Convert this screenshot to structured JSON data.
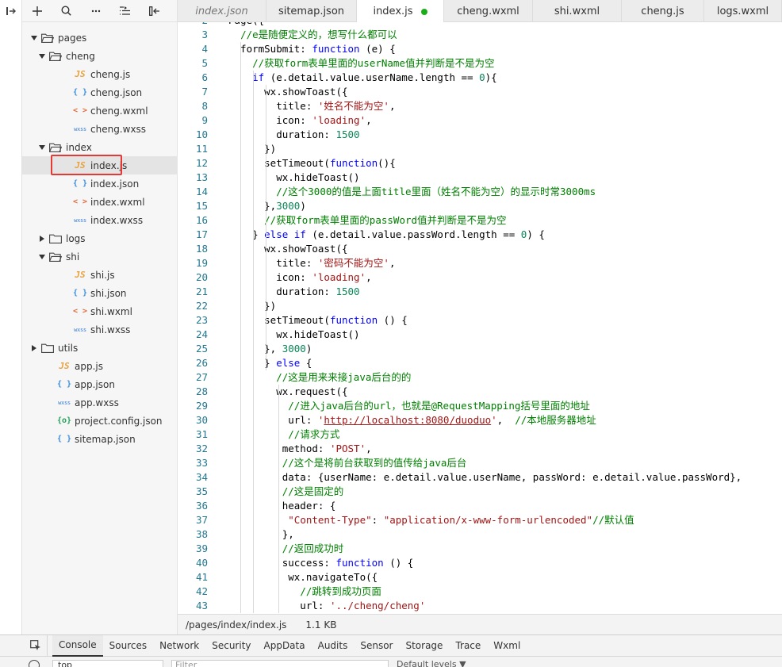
{
  "sidebar": {
    "toolbar_icons": [
      "add-icon",
      "search-icon",
      "more-icon",
      "outline-icon",
      "collapse-icon"
    ],
    "tree": [
      {
        "label": "pages",
        "kind": "folder",
        "expanded": true,
        "depth": 0
      },
      {
        "label": "cheng",
        "kind": "folder",
        "expanded": true,
        "depth": 1
      },
      {
        "label": "cheng.js",
        "kind": "js",
        "depth": 2
      },
      {
        "label": "cheng.json",
        "kind": "json",
        "depth": 2
      },
      {
        "label": "cheng.wxml",
        "kind": "wxml",
        "depth": 2
      },
      {
        "label": "cheng.wxss",
        "kind": "wxss",
        "depth": 2
      },
      {
        "label": "index",
        "kind": "folder",
        "expanded": true,
        "depth": 1
      },
      {
        "label": "index.js",
        "kind": "js",
        "depth": 2,
        "selected": true
      },
      {
        "label": "index.json",
        "kind": "json",
        "depth": 2
      },
      {
        "label": "index.wxml",
        "kind": "wxml",
        "depth": 2
      },
      {
        "label": "index.wxss",
        "kind": "wxss",
        "depth": 2
      },
      {
        "label": "logs",
        "kind": "folder",
        "expanded": false,
        "depth": 1
      },
      {
        "label": "shi",
        "kind": "folder",
        "expanded": true,
        "depth": 1
      },
      {
        "label": "shi.js",
        "kind": "js",
        "depth": 2
      },
      {
        "label": "shi.json",
        "kind": "json",
        "depth": 2
      },
      {
        "label": "shi.wxml",
        "kind": "wxml",
        "depth": 2
      },
      {
        "label": "shi.wxss",
        "kind": "wxss",
        "depth": 2
      },
      {
        "label": "utils",
        "kind": "folder",
        "expanded": false,
        "depth": 0
      },
      {
        "label": "app.js",
        "kind": "js",
        "depth": 1
      },
      {
        "label": "app.json",
        "kind": "json",
        "depth": 1
      },
      {
        "label": "app.wxss",
        "kind": "wxss",
        "depth": 1
      },
      {
        "label": "project.config.json",
        "kind": "cfg",
        "depth": 1
      },
      {
        "label": "sitemap.json",
        "kind": "json",
        "depth": 1
      }
    ],
    "file_icon_text": {
      "js": "JS",
      "json": "{ }",
      "wxml": "< >",
      "wxss": "wxss",
      "cfg": "{o}"
    }
  },
  "tabs": [
    {
      "label": "index.json",
      "preview": true
    },
    {
      "label": "sitemap.json"
    },
    {
      "label": "index.js",
      "active": true,
      "modified": true
    },
    {
      "label": "cheng.wxml"
    },
    {
      "label": "shi.wxml"
    },
    {
      "label": "cheng.js"
    },
    {
      "label": "logs.wxml"
    }
  ],
  "editor": {
    "first_line": 2,
    "lines": [
      [
        {
          "t": "Page({",
          "c": ""
        }
      ],
      [
        {
          "t": "  ",
          "c": ""
        },
        {
          "t": "//e是随便定义的，想写什么都可以",
          "c": "c"
        }
      ],
      [
        {
          "t": "  formSubmit: ",
          "c": ""
        },
        {
          "t": "function",
          "c": "k"
        },
        {
          "t": " (e) {",
          "c": ""
        }
      ],
      [
        {
          "t": "    ",
          "c": ""
        },
        {
          "t": "//获取form表单里面的userName值并判断是不是为空",
          "c": "c"
        }
      ],
      [
        {
          "t": "    ",
          "c": ""
        },
        {
          "t": "if",
          "c": "k"
        },
        {
          "t": " (e.detail.value.userName.length == ",
          "c": ""
        },
        {
          "t": "0",
          "c": "n"
        },
        {
          "t": "){",
          "c": ""
        }
      ],
      [
        {
          "t": "      wx.showToast({",
          "c": ""
        }
      ],
      [
        {
          "t": "        title: ",
          "c": ""
        },
        {
          "t": "'姓名不能为空'",
          "c": "s"
        },
        {
          "t": ",",
          "c": ""
        }
      ],
      [
        {
          "t": "        icon: ",
          "c": ""
        },
        {
          "t": "'loading'",
          "c": "s"
        },
        {
          "t": ",",
          "c": ""
        }
      ],
      [
        {
          "t": "        duration: ",
          "c": ""
        },
        {
          "t": "1500",
          "c": "n"
        }
      ],
      [
        {
          "t": "      })",
          "c": ""
        }
      ],
      [
        {
          "t": "      setTimeout(",
          "c": ""
        },
        {
          "t": "function",
          "c": "k"
        },
        {
          "t": "(){",
          "c": ""
        }
      ],
      [
        {
          "t": "        wx.hideToast()",
          "c": ""
        }
      ],
      [
        {
          "t": "        ",
          "c": ""
        },
        {
          "t": "//这个3000的值是上面title里面（姓名不能为空）的显示时常3000ms",
          "c": "c"
        }
      ],
      [
        {
          "t": "      },",
          "c": ""
        },
        {
          "t": "3000",
          "c": "n"
        },
        {
          "t": ")",
          "c": ""
        }
      ],
      [
        {
          "t": "      ",
          "c": ""
        },
        {
          "t": "//获取form表单里面的passWord值并判断是不是为空",
          "c": "c"
        }
      ],
      [
        {
          "t": "    } ",
          "c": ""
        },
        {
          "t": "else if",
          "c": "k"
        },
        {
          "t": " (e.detail.value.passWord.length == ",
          "c": ""
        },
        {
          "t": "0",
          "c": "n"
        },
        {
          "t": ") {",
          "c": ""
        }
      ],
      [
        {
          "t": "      wx.showToast({",
          "c": ""
        }
      ],
      [
        {
          "t": "        title: ",
          "c": ""
        },
        {
          "t": "'密码不能为空'",
          "c": "s"
        },
        {
          "t": ",",
          "c": ""
        }
      ],
      [
        {
          "t": "        icon: ",
          "c": ""
        },
        {
          "t": "'loading'",
          "c": "s"
        },
        {
          "t": ",",
          "c": ""
        }
      ],
      [
        {
          "t": "        duration: ",
          "c": ""
        },
        {
          "t": "1500",
          "c": "n"
        }
      ],
      [
        {
          "t": "      })",
          "c": ""
        }
      ],
      [
        {
          "t": "      setTimeout(",
          "c": ""
        },
        {
          "t": "function",
          "c": "k"
        },
        {
          "t": " () {",
          "c": ""
        }
      ],
      [
        {
          "t": "        wx.hideToast()",
          "c": ""
        }
      ],
      [
        {
          "t": "      }, ",
          "c": ""
        },
        {
          "t": "3000",
          "c": "n"
        },
        {
          "t": ")",
          "c": ""
        }
      ],
      [
        {
          "t": "      } ",
          "c": ""
        },
        {
          "t": "else",
          "c": "k"
        },
        {
          "t": " {",
          "c": ""
        }
      ],
      [
        {
          "t": "        ",
          "c": ""
        },
        {
          "t": "//这是用来来接java后台的的",
          "c": "c"
        }
      ],
      [
        {
          "t": "        wx.request({",
          "c": ""
        }
      ],
      [
        {
          "t": "          ",
          "c": ""
        },
        {
          "t": "//进入java后台的url，也就是@RequestMapping括号里面的地址",
          "c": "c"
        }
      ],
      [
        {
          "t": "          url: ",
          "c": ""
        },
        {
          "t": "'",
          "c": "s"
        },
        {
          "t": "http://localhost:8080/duoduo",
          "c": "s u"
        },
        {
          "t": "'",
          "c": "s"
        },
        {
          "t": ",  ",
          "c": ""
        },
        {
          "t": "//本地服务器地址",
          "c": "c"
        }
      ],
      [
        {
          "t": "          ",
          "c": ""
        },
        {
          "t": "//请求方式",
          "c": "c"
        }
      ],
      [
        {
          "t": "         method: ",
          "c": ""
        },
        {
          "t": "'POST'",
          "c": "s"
        },
        {
          "t": ",",
          "c": ""
        }
      ],
      [
        {
          "t": "         ",
          "c": ""
        },
        {
          "t": "//这个是将前台获取到的值传给java后台",
          "c": "c"
        }
      ],
      [
        {
          "t": "         data: {userName: e.detail.value.userName, passWord: e.detail.value.passWord},",
          "c": ""
        }
      ],
      [
        {
          "t": "         ",
          "c": ""
        },
        {
          "t": "//这是固定的",
          "c": "c"
        }
      ],
      [
        {
          "t": "         header: {",
          "c": ""
        }
      ],
      [
        {
          "t": "          ",
          "c": ""
        },
        {
          "t": "\"Content-Type\"",
          "c": "s"
        },
        {
          "t": ": ",
          "c": ""
        },
        {
          "t": "\"application/x-www-form-urlencoded\"",
          "c": "s"
        },
        {
          "t": "//默认值",
          "c": "c"
        }
      ],
      [
        {
          "t": "         },",
          "c": ""
        }
      ],
      [
        {
          "t": "         ",
          "c": ""
        },
        {
          "t": "//返回成功时",
          "c": "c"
        }
      ],
      [
        {
          "t": "         success: ",
          "c": ""
        },
        {
          "t": "function",
          "c": "k"
        },
        {
          "t": " () {",
          "c": ""
        }
      ],
      [
        {
          "t": "          wx.navigateTo({",
          "c": ""
        }
      ],
      [
        {
          "t": "            ",
          "c": ""
        },
        {
          "t": "//跳转到成功页面",
          "c": "c"
        }
      ],
      [
        {
          "t": "            url: ",
          "c": ""
        },
        {
          "t": "'../cheng/cheng'",
          "c": "s"
        }
      ]
    ]
  },
  "statusbar": {
    "path": "/pages/index/index.js",
    "size": "1.1 KB"
  },
  "devtools": {
    "tabs": [
      "Console",
      "Sources",
      "Network",
      "Security",
      "AppData",
      "Audits",
      "Sensor",
      "Storage",
      "Trace",
      "Wxml"
    ],
    "active_tab": "Console",
    "context": "top",
    "filter_placeholder": "Filter",
    "levels": "Default levels ▼"
  }
}
